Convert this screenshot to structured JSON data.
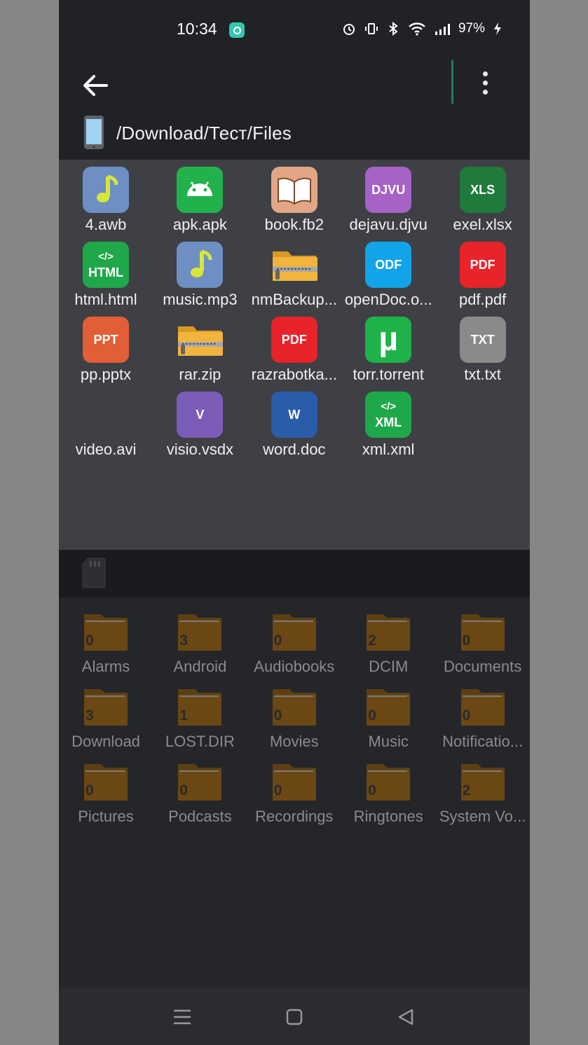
{
  "status": {
    "time": "10:34",
    "battery": "97%"
  },
  "path": "/Download/Тест/Files",
  "files": [
    {
      "name": "4.awb",
      "icon": "music-note-icon",
      "color": "#6e8fc4",
      "label": ""
    },
    {
      "name": "apk.apk",
      "icon": "android-icon",
      "color": "#22b24c",
      "label": ""
    },
    {
      "name": "book.fb2",
      "icon": "book-icon",
      "color": "#e2a686",
      "label": ""
    },
    {
      "name": "dejavu.djvu",
      "icon": "djvu-icon",
      "color": "#a662c4",
      "label": "DJVU"
    },
    {
      "name": "exel.xlsx",
      "icon": "xls-icon",
      "color": "#1f7a3c",
      "label": "XLS"
    },
    {
      "name": "html.html",
      "icon": "html-icon",
      "color": "#1fa84a",
      "label": "</>\nHTML"
    },
    {
      "name": "music.mp3",
      "icon": "music-note-icon",
      "color": "#6e8fc4",
      "label": ""
    },
    {
      "name": "nmBackup...",
      "icon": "zip-folder-icon",
      "color": "#f0a830",
      "label": ""
    },
    {
      "name": "openDoc.o...",
      "icon": "odf-icon",
      "color": "#12a4e8",
      "label": "ODF"
    },
    {
      "name": "pdf.pdf",
      "icon": "pdf-icon",
      "color": "#e8232a",
      "label": "PDF"
    },
    {
      "name": "pp.pptx",
      "icon": "ppt-icon",
      "color": "#e25e36",
      "label": "PPT"
    },
    {
      "name": "rar.zip",
      "icon": "zip-folder-icon",
      "color": "#f0a830",
      "label": ""
    },
    {
      "name": "razrabotka...",
      "icon": "pdf-icon",
      "color": "#e8232a",
      "label": "PDF"
    },
    {
      "name": "torr.torrent",
      "icon": "torrent-icon",
      "color": "#1fb24a",
      "label": "µ"
    },
    {
      "name": "txt.txt",
      "icon": "txt-icon",
      "color": "#8a8a8a",
      "label": "TXT"
    },
    {
      "name": "video.avi",
      "icon": "video-icon",
      "color": "",
      "label": ""
    },
    {
      "name": "visio.vsdx",
      "icon": "visio-icon",
      "color": "#7b5cb8",
      "label": "V"
    },
    {
      "name": "word.doc",
      "icon": "word-icon",
      "color": "#2a5caa",
      "label": "W"
    },
    {
      "name": "xml.xml",
      "icon": "xml-icon",
      "color": "#1fa84a",
      "label": "</>\nXML"
    }
  ],
  "folders": [
    {
      "name": "Alarms",
      "count": "0"
    },
    {
      "name": "Android",
      "count": "3"
    },
    {
      "name": "Audiobooks",
      "count": "0"
    },
    {
      "name": "DCIM",
      "count": "2"
    },
    {
      "name": "Documents",
      "count": "0"
    },
    {
      "name": "Download",
      "count": "3"
    },
    {
      "name": "LOST.DIR",
      "count": "1"
    },
    {
      "name": "Movies",
      "count": "0"
    },
    {
      "name": "Music",
      "count": "0"
    },
    {
      "name": "Notificatio...",
      "count": "0"
    },
    {
      "name": "Pictures",
      "count": "0"
    },
    {
      "name": "Podcasts",
      "count": "0"
    },
    {
      "name": "Recordings",
      "count": "0"
    },
    {
      "name": "Ringtones",
      "count": "0"
    },
    {
      "name": "System Vo...",
      "count": "2"
    }
  ]
}
